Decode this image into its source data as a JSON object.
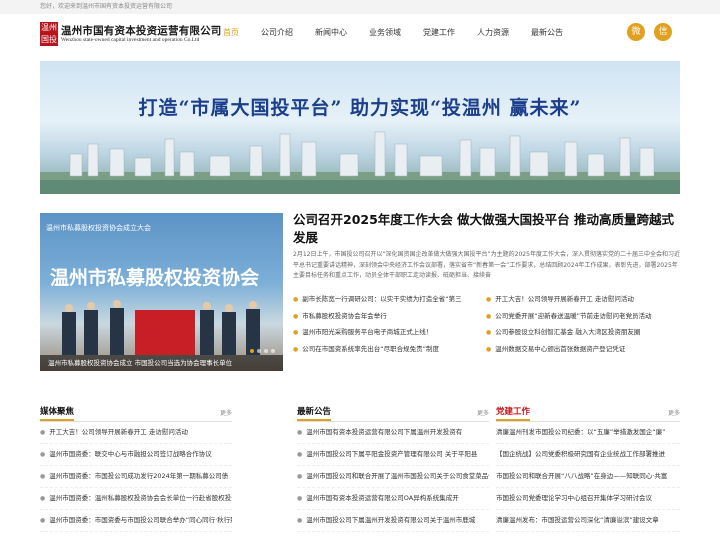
{
  "topbar": {
    "text": "您好，欢迎来到温州市国有资本投资运营有限公司"
  },
  "logo": {
    "seal": "温州国投",
    "cn": "温州市国有资本投资运营有限公司",
    "en": "Wenzhou state-owned capital investment and operation Co.Ltd"
  },
  "nav": {
    "items": [
      "首页",
      "公司介绍",
      "新闻中心",
      "业务领域",
      "党建工作",
      "人力资源",
      "最新公告"
    ]
  },
  "social": {
    "weibo": "微",
    "wechat": "信"
  },
  "banner": {
    "slogan": "打造“市属大国投平台”  助力实现“投温州 赢未来”"
  },
  "slider": {
    "title": "温州市私募股权投资协会成立大会",
    "big": "温州市私募股权投资协会",
    "caption": "温州市私募股权投资协会成立 市国投公司当选为协会理事长单位"
  },
  "headline": "公司召开2025年度工作大会 做大做强大国投平台 推动高质量跨越式发展",
  "summary": "2月12日上午，市国投公司召开以“深化国资国企改革做大做强大国投平台”为主题的2025年度工作大会，深入贯彻落实党的二十届三中全会和习近平总书记重要讲话精神，深刻领会中央经济工作会议部署，落实省市“新春第一会”工作要求，总结回顾2024年工作成果，表彰先进，部署2025年主要目标任务和重点工作，动员全体干部职工走动读报、砥砺担当、接续奋",
  "news": [
    [
      "副市长陈宽一行调研公司：以实干实绩为打造全省“第三",
      "开工大吉！公司领导开展新春开工 走访慰问活动"
    ],
    [
      "市私募股权投资协会年会举行",
      "公司党委开展“迎新春送温暖”节前走访慰问老党员活动"
    ],
    [
      "温州市阳光采购服务平台电子商城正式上线！",
      "公司参股设立科创智汇基金 融入大湾区投资朋友圈"
    ],
    [
      "公司在市国资系统率先出台“尽职合规免责”制度",
      "温州数据交易中心颁出首张数据资产登记凭证"
    ]
  ],
  "columns": [
    {
      "title": "媒体聚焦",
      "more": "更多",
      "items": [
        "开工大吉！公司领导开展新春开工 走访慰问活动",
        "温州市国资委：联交中心与市融担公司签订战略合作协议",
        "温州市国资委：市国投公司成功发行2024年第一期私募公司债",
        "温州市国资委：温州私募股权投资协会会长单位一行赴省股权投资行业协",
        "温州市国资委：市国资委与市国投公司联合举办“同心同行·秋行致远”户外"
      ]
    },
    {
      "title": "最新公告",
      "more": "更多",
      "items": [
        "温州市国有资本投资运营有限公司下属温州开发投资有",
        "温州市国投公司下属平阳金投资产管理有限公司 关于平阳县",
        "温州市国投公司和联合开展了温州市国投公司关于公司食堂菜品供",
        "温州市国有资本投资运营有限公司OA异构系统集成开",
        "温州市国投公司下属温州开发投资有限公司关于温州市鹿城"
      ]
    },
    {
      "title": "党建工作",
      "more": "更多",
      "items": [
        "清廉温州刊发市国投公司纪委：以“五廉”举措激发国企“廉”",
        "【国企统战】公司党委积极研究国有企业统战工作部署推进",
        "市国投公司和联合开展“八八战略”在身边——知联同心·共富",
        "市国投公司党委理论学习中心组召开集体学习研讨会议",
        "清廉温州发布：市国投运营公司深化“清廉溢滨”建设文章"
      ]
    }
  ]
}
